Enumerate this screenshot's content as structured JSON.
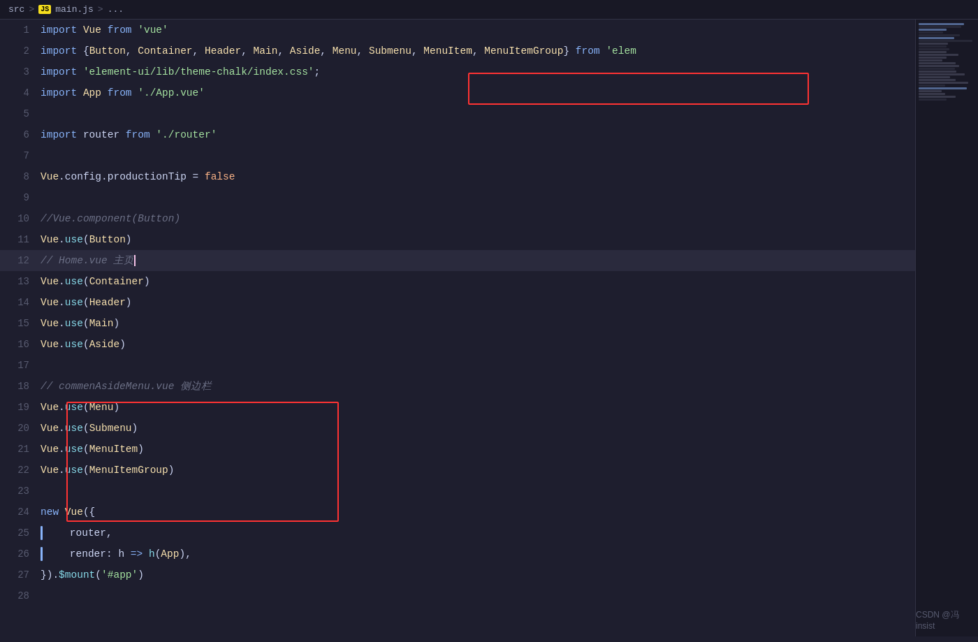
{
  "breadcrumb": {
    "src": "src",
    "sep1": ">",
    "js_label": "JS",
    "filename": "main.js",
    "sep2": ">",
    "ellipsis": "..."
  },
  "watermark": "CSDN @冯insist",
  "lines": [
    {
      "num": 1,
      "tokens": [
        {
          "t": "kw",
          "v": "import "
        },
        {
          "t": "cls",
          "v": "Vue"
        },
        {
          "t": "kw",
          "v": " from "
        },
        {
          "t": "str",
          "v": "'vue'"
        }
      ]
    },
    {
      "num": 2,
      "tokens": [
        {
          "t": "kw",
          "v": "import "
        },
        {
          "t": "punct",
          "v": "{"
        },
        {
          "t": "cls",
          "v": "Button"
        },
        {
          "t": "punct",
          "v": ", "
        },
        {
          "t": "cls",
          "v": "Container"
        },
        {
          "t": "punct",
          "v": ", "
        },
        {
          "t": "cls",
          "v": "Header"
        },
        {
          "t": "punct",
          "v": ", "
        },
        {
          "t": "cls",
          "v": "Main"
        },
        {
          "t": "punct",
          "v": ", "
        },
        {
          "t": "cls",
          "v": "Aside"
        },
        {
          "t": "punct",
          "v": ", "
        },
        {
          "t": "cls",
          "v": "Menu"
        },
        {
          "t": "punct",
          "v": ", "
        },
        {
          "t": "cls",
          "v": "Submenu"
        },
        {
          "t": "punct",
          "v": ", "
        },
        {
          "t": "cls",
          "v": "MenuItem"
        },
        {
          "t": "punct",
          "v": ", "
        },
        {
          "t": "cls",
          "v": "MenuItemGroup"
        },
        {
          "t": "punct",
          "v": "}"
        },
        {
          "t": "kw",
          "v": " from "
        },
        {
          "t": "str",
          "v": "'elem"
        }
      ]
    },
    {
      "num": 3,
      "tokens": [
        {
          "t": "kw",
          "v": "import "
        },
        {
          "t": "str",
          "v": "'element-ui/lib/theme-chalk/index.css'"
        },
        {
          "t": "punct",
          "v": ";"
        }
      ]
    },
    {
      "num": 4,
      "tokens": [
        {
          "t": "kw",
          "v": "import "
        },
        {
          "t": "cls",
          "v": "App"
        },
        {
          "t": "kw",
          "v": " from "
        },
        {
          "t": "str",
          "v": "'./App.vue'"
        }
      ]
    },
    {
      "num": 5,
      "tokens": []
    },
    {
      "num": 6,
      "tokens": [
        {
          "t": "kw",
          "v": "import "
        },
        {
          "t": "plain",
          "v": "router"
        },
        {
          "t": "kw",
          "v": " from "
        },
        {
          "t": "str",
          "v": "'./router'"
        }
      ]
    },
    {
      "num": 7,
      "tokens": []
    },
    {
      "num": 8,
      "tokens": [
        {
          "t": "cls",
          "v": "Vue"
        },
        {
          "t": "punct",
          "v": "."
        },
        {
          "t": "plain",
          "v": "config"
        },
        {
          "t": "punct",
          "v": "."
        },
        {
          "t": "plain",
          "v": "productionTip "
        },
        {
          "t": "punct",
          "v": "= "
        },
        {
          "t": "val",
          "v": "false"
        }
      ]
    },
    {
      "num": 9,
      "tokens": []
    },
    {
      "num": 10,
      "tokens": [
        {
          "t": "comment",
          "v": "//Vue.component(Button)"
        }
      ]
    },
    {
      "num": 11,
      "tokens": [
        {
          "t": "cls",
          "v": "Vue"
        },
        {
          "t": "punct",
          "v": "."
        },
        {
          "t": "fn",
          "v": "use"
        },
        {
          "t": "punct",
          "v": "("
        },
        {
          "t": "cls",
          "v": "Button"
        },
        {
          "t": "punct",
          "v": ")"
        }
      ]
    },
    {
      "num": 12,
      "tokens": [
        {
          "t": "comment",
          "v": "// Home.vue 主页"
        },
        {
          "t": "cursor",
          "v": ""
        }
      ],
      "active": true
    },
    {
      "num": 13,
      "tokens": [
        {
          "t": "cls",
          "v": "Vue"
        },
        {
          "t": "punct",
          "v": "."
        },
        {
          "t": "fn",
          "v": "use"
        },
        {
          "t": "punct",
          "v": "("
        },
        {
          "t": "cls",
          "v": "Container"
        },
        {
          "t": "punct",
          "v": ")"
        }
      ]
    },
    {
      "num": 14,
      "tokens": [
        {
          "t": "cls",
          "v": "Vue"
        },
        {
          "t": "punct",
          "v": "."
        },
        {
          "t": "fn",
          "v": "use"
        },
        {
          "t": "punct",
          "v": "("
        },
        {
          "t": "cls",
          "v": "Header"
        },
        {
          "t": "punct",
          "v": ")"
        }
      ]
    },
    {
      "num": 15,
      "tokens": [
        {
          "t": "cls",
          "v": "Vue"
        },
        {
          "t": "punct",
          "v": "."
        },
        {
          "t": "fn",
          "v": "use"
        },
        {
          "t": "punct",
          "v": "("
        },
        {
          "t": "cls",
          "v": "Main"
        },
        {
          "t": "punct",
          "v": ")"
        }
      ]
    },
    {
      "num": 16,
      "tokens": [
        {
          "t": "cls",
          "v": "Vue"
        },
        {
          "t": "punct",
          "v": "."
        },
        {
          "t": "fn",
          "v": "use"
        },
        {
          "t": "punct",
          "v": "("
        },
        {
          "t": "cls",
          "v": "Aside"
        },
        {
          "t": "punct",
          "v": ")"
        }
      ]
    },
    {
      "num": 17,
      "tokens": []
    },
    {
      "num": 18,
      "tokens": [
        {
          "t": "comment",
          "v": "// commenAsideMenu.vue 侧边栏"
        }
      ]
    },
    {
      "num": 19,
      "tokens": [
        {
          "t": "cls",
          "v": "Vue"
        },
        {
          "t": "punct",
          "v": "."
        },
        {
          "t": "fn",
          "v": "use"
        },
        {
          "t": "punct",
          "v": "("
        },
        {
          "t": "cls",
          "v": "Menu"
        },
        {
          "t": "punct",
          "v": ")"
        }
      ]
    },
    {
      "num": 20,
      "tokens": [
        {
          "t": "cls",
          "v": "Vue"
        },
        {
          "t": "punct",
          "v": "."
        },
        {
          "t": "fn",
          "v": "use"
        },
        {
          "t": "punct",
          "v": "("
        },
        {
          "t": "cls",
          "v": "Submenu"
        },
        {
          "t": "punct",
          "v": ")"
        }
      ]
    },
    {
      "num": 21,
      "tokens": [
        {
          "t": "cls",
          "v": "Vue"
        },
        {
          "t": "punct",
          "v": "."
        },
        {
          "t": "fn",
          "v": "use"
        },
        {
          "t": "punct",
          "v": "("
        },
        {
          "t": "cls",
          "v": "MenuItem"
        },
        {
          "t": "punct",
          "v": ")"
        }
      ]
    },
    {
      "num": 22,
      "tokens": [
        {
          "t": "cls",
          "v": "Vue"
        },
        {
          "t": "punct",
          "v": "."
        },
        {
          "t": "fn",
          "v": "use"
        },
        {
          "t": "punct",
          "v": "("
        },
        {
          "t": "cls",
          "v": "MenuItemGroup"
        },
        {
          "t": "punct",
          "v": ")"
        }
      ]
    },
    {
      "num": 23,
      "tokens": []
    },
    {
      "num": 24,
      "tokens": [
        {
          "t": "kw",
          "v": "new "
        },
        {
          "t": "cls",
          "v": "Vue"
        },
        {
          "t": "punct",
          "v": "({"
        }
      ]
    },
    {
      "num": 25,
      "tokens": [
        {
          "t": "plain",
          "v": "    router"
        },
        {
          "t": "punct",
          "v": ","
        }
      ],
      "bar": true
    },
    {
      "num": 26,
      "tokens": [
        {
          "t": "plain",
          "v": "    render"
        },
        {
          "t": "punct",
          "v": ": "
        },
        {
          "t": "plain",
          "v": "h "
        },
        {
          "t": "kw",
          "v": "=> "
        },
        {
          "t": "fn",
          "v": "h"
        },
        {
          "t": "punct",
          "v": "("
        },
        {
          "t": "cls",
          "v": "App"
        },
        {
          "t": "punct",
          "v": ")"
        },
        {
          "t": "punct",
          "v": ","
        }
      ],
      "bar": true
    },
    {
      "num": 27,
      "tokens": [
        {
          "t": "punct",
          "v": "}"
        },
        {
          "t": "punct",
          "v": ")"
        },
        {
          "t": "punct",
          "v": "."
        },
        {
          "t": "fn",
          "v": "$mount"
        },
        {
          "t": "punct",
          "v": "("
        },
        {
          "t": "str",
          "v": "'#app'"
        },
        {
          "t": "punct",
          "v": ")"
        }
      ]
    },
    {
      "num": 28,
      "tokens": []
    }
  ]
}
